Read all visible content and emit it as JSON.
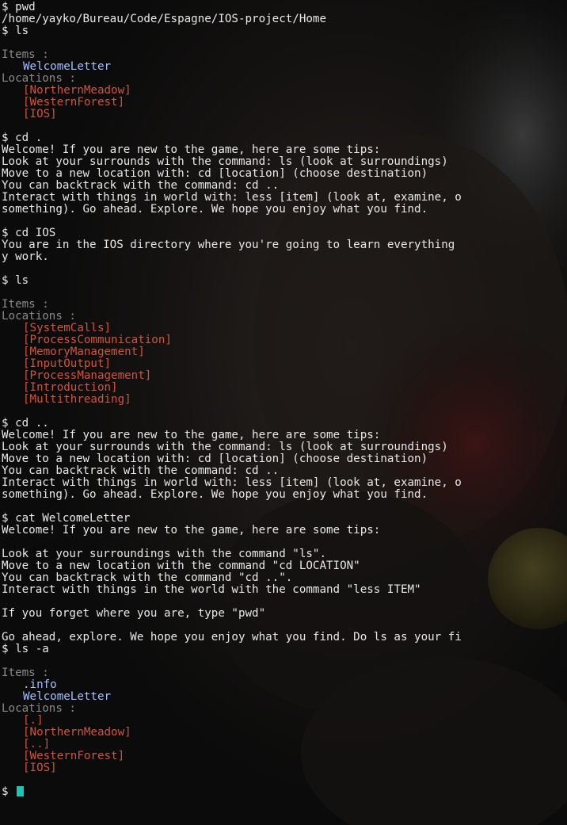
{
  "colors": {
    "background": "#0b0b0b",
    "text": "#e8e8e8",
    "label": "#8a8a8a",
    "item": "#a4c0ff",
    "location": "#d2543a",
    "cursor": "#19c8b4"
  },
  "lines": [
    {
      "text": "$ pwd",
      "kind": "text"
    },
    {
      "text": "/home/yayko/Bureau/Code/Espagne/IOS-project/Home",
      "kind": "text"
    },
    {
      "text": "$ ls",
      "kind": "text"
    },
    {
      "text": "",
      "kind": "blank"
    },
    {
      "text": "Items :",
      "kind": "label"
    },
    {
      "text": "WelcomeLetter",
      "kind": "item"
    },
    {
      "text": "Locations :",
      "kind": "label"
    },
    {
      "text": "[NorthernMeadow]",
      "kind": "location"
    },
    {
      "text": "[WesternForest]",
      "kind": "location"
    },
    {
      "text": "[IOS]",
      "kind": "location"
    },
    {
      "text": "",
      "kind": "blank"
    },
    {
      "text": "$ cd .",
      "kind": "text"
    },
    {
      "text": "Welcome! If you are new to the game, here are some tips:",
      "kind": "text"
    },
    {
      "text": "Look at your surrounds with the command: ls (look at surroundings)",
      "kind": "text"
    },
    {
      "text": "Move to a new location with: cd [location] (choose destination)",
      "kind": "text"
    },
    {
      "text": "You can backtrack with the command: cd ..",
      "kind": "text"
    },
    {
      "text": "Interact with things in world with: less [item] (look at, examine, o",
      "kind": "text"
    },
    {
      "text": "something). Go ahead. Explore. We hope you enjoy what you find.",
      "kind": "text"
    },
    {
      "text": "",
      "kind": "blank"
    },
    {
      "text": "$ cd IOS",
      "kind": "text"
    },
    {
      "text": "You are in the IOS directory where you're going to learn everything",
      "kind": "text"
    },
    {
      "text": "y work.",
      "kind": "text"
    },
    {
      "text": "",
      "kind": "blank"
    },
    {
      "text": "$ ls",
      "kind": "text"
    },
    {
      "text": "",
      "kind": "blank"
    },
    {
      "text": "Items :",
      "kind": "label"
    },
    {
      "text": "Locations :",
      "kind": "label"
    },
    {
      "text": "[SystemCalls]",
      "kind": "location"
    },
    {
      "text": "[ProcessCommunication]",
      "kind": "location"
    },
    {
      "text": "[MemoryManagement]",
      "kind": "location"
    },
    {
      "text": "[InputOutput]",
      "kind": "location"
    },
    {
      "text": "[ProcessManagement]",
      "kind": "location"
    },
    {
      "text": "[Introduction]",
      "kind": "location"
    },
    {
      "text": "[Multithreading]",
      "kind": "location"
    },
    {
      "text": "",
      "kind": "blank"
    },
    {
      "text": "$ cd ..",
      "kind": "text"
    },
    {
      "text": "Welcome! If you are new to the game, here are some tips:",
      "kind": "text"
    },
    {
      "text": "Look at your surrounds with the command: ls (look at surroundings)",
      "kind": "text"
    },
    {
      "text": "Move to a new location with: cd [location] (choose destination)",
      "kind": "text"
    },
    {
      "text": "You can backtrack with the command: cd ..",
      "kind": "text"
    },
    {
      "text": "Interact with things in world with: less [item] (look at, examine, o",
      "kind": "text"
    },
    {
      "text": "something). Go ahead. Explore. We hope you enjoy what you find.",
      "kind": "text"
    },
    {
      "text": "",
      "kind": "blank"
    },
    {
      "text": "$ cat WelcomeLetter",
      "kind": "text"
    },
    {
      "text": "Welcome! If you are new to the game, here are some tips:",
      "kind": "text"
    },
    {
      "text": "",
      "kind": "blank"
    },
    {
      "text": "Look at your surroundings with the command \"ls\".",
      "kind": "text"
    },
    {
      "text": "Move to a new location with the command \"cd LOCATION\"",
      "kind": "text"
    },
    {
      "text": "You can backtrack with the command \"cd ..\".",
      "kind": "text"
    },
    {
      "text": "Interact with things in the world with the command \"less ITEM\"",
      "kind": "text"
    },
    {
      "text": "",
      "kind": "blank"
    },
    {
      "text": "If you forget where you are, type \"pwd\"",
      "kind": "text"
    },
    {
      "text": "",
      "kind": "blank"
    },
    {
      "text": "Go ahead, explore. We hope you enjoy what you find. Do ls as your fi",
      "kind": "text"
    },
    {
      "text": "$ ls -a",
      "kind": "text"
    },
    {
      "text": "",
      "kind": "blank"
    },
    {
      "text": "Items :",
      "kind": "label"
    },
    {
      "text": ".info",
      "kind": "item"
    },
    {
      "text": "WelcomeLetter",
      "kind": "item"
    },
    {
      "text": "Locations :",
      "kind": "label"
    },
    {
      "text": "[.]",
      "kind": "location"
    },
    {
      "text": "[NorthernMeadow]",
      "kind": "location"
    },
    {
      "text": "[..]",
      "kind": "location"
    },
    {
      "text": "[WesternForest]",
      "kind": "location"
    },
    {
      "text": "[IOS]",
      "kind": "location"
    },
    {
      "text": "",
      "kind": "blank"
    }
  ],
  "prompt": {
    "symbol": "$ ",
    "input": ""
  }
}
